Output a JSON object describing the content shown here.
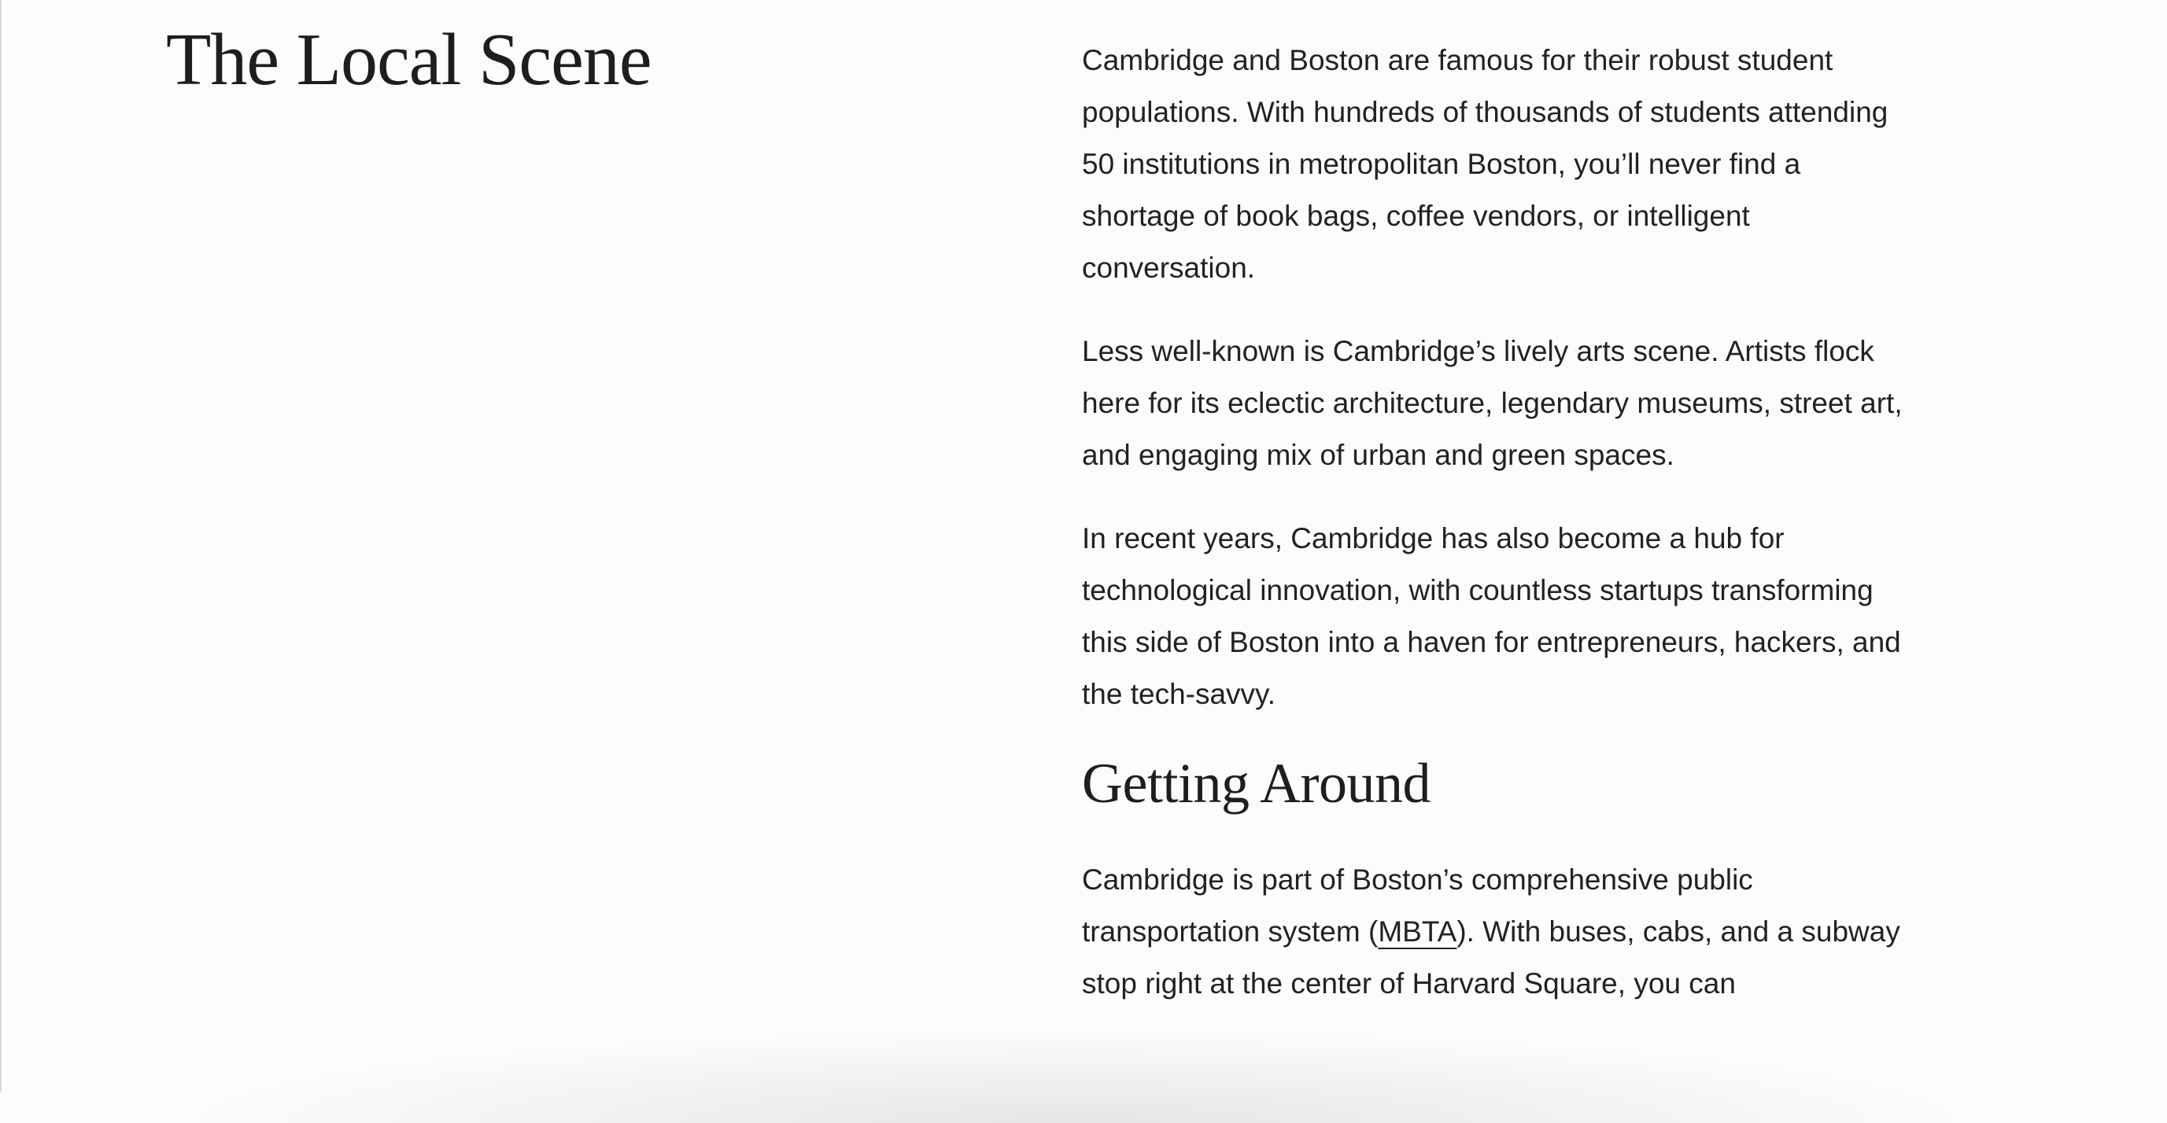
{
  "section_title": "The Local Scene",
  "paragraphs": [
    "Cambridge and Boston are famous for their robust student populations. With hundreds of thousands of students attending 50 institutions in metropolitan Boston, you’ll never find a shortage of book bags, coffee vendors, or intelligent conversation.",
    "Less well-known is Cambridge’s lively arts scene. Artists flock here for its eclectic architecture, legendary museums, street art, and engaging mix of urban and green spaces.",
    "In recent years, Cambridge has also become a hub for technological innovation, with countless startups transforming this side of Boston into a haven for entrepreneurs, hackers, and the tech-savvy."
  ],
  "getting_around": {
    "heading": "Getting Around",
    "text_before_link": "Cambridge is part of Boston’s comprehensive public transportation system (",
    "link_label": "MBTA",
    "text_after_link": "). With buses, cabs, and a subway stop right at the center of Harvard Square, you can"
  }
}
